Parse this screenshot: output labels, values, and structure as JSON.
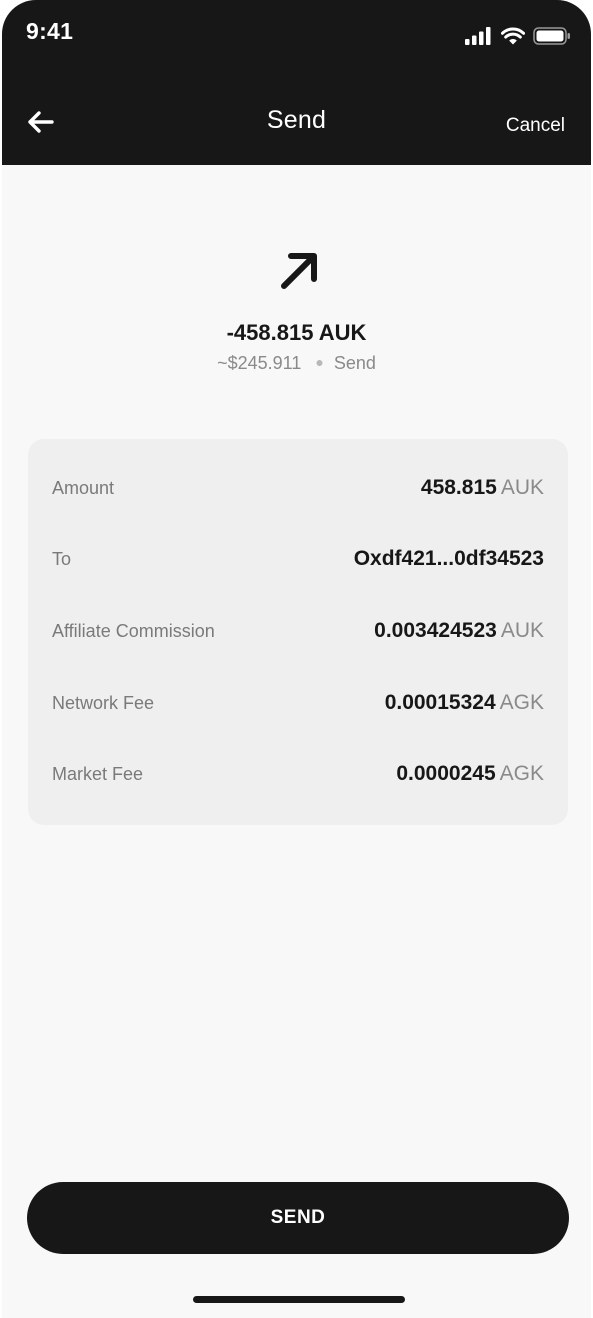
{
  "status_bar": {
    "time": "9:41",
    "icons": [
      "signal-icon",
      "wifi-icon",
      "battery-icon"
    ]
  },
  "header": {
    "title": "Send",
    "cancel_label": "Cancel",
    "back_icon": "back-arrow-icon"
  },
  "summary": {
    "icon": "arrow-up-right-icon",
    "amount": "-458.815 AUK",
    "fiat": "~$245.911",
    "type": "Send"
  },
  "details": {
    "rows": [
      {
        "label": "Amount",
        "value": "458.815",
        "unit": "AUK"
      },
      {
        "label": "To",
        "value": "Oxdf421...0df34523",
        "unit": ""
      },
      {
        "label": "Affiliate Commission",
        "value": "0.003424523",
        "unit": "AUK"
      },
      {
        "label": "Network Fee",
        "value": "0.00015324",
        "unit": "AGK"
      },
      {
        "label": "Market Fee",
        "value": "0.0000245",
        "unit": "AGK"
      }
    ]
  },
  "action": {
    "send_label": "SEND"
  },
  "colors": {
    "header_bg": "#171717",
    "page_bg": "#f8f8f8",
    "card_bg": "#efefef",
    "text_primary": "#171717",
    "text_secondary": "#7a7a7a"
  }
}
